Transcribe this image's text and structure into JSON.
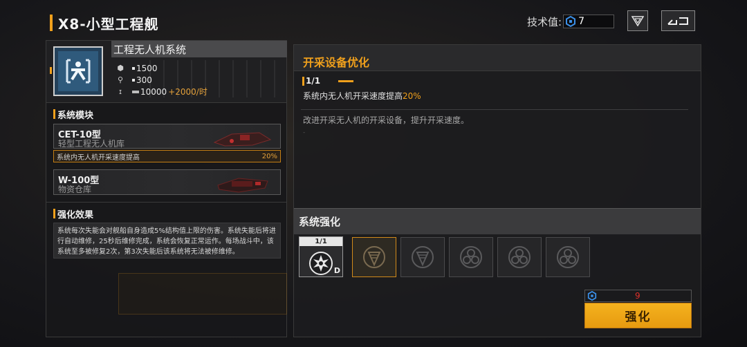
{
  "header": {
    "title": "X8-小型工程舰",
    "tech_label": "技术值:",
    "tech_value": "7",
    "filter_icon": "triangle-filter-icon",
    "back_icon": "back-arrow-icon"
  },
  "system": {
    "name": "工程无人机系统",
    "icon": "engineering-drone-icon",
    "stats": {
      "capacity": "1500",
      "drones": "300",
      "energy": "10000",
      "energy_rate": "+2000/时"
    }
  },
  "modules": {
    "section_title": "系统模块",
    "items": [
      {
        "code": "CET-10型",
        "type": "轻型工程无人机库"
      },
      {
        "code": "W-100型",
        "type": "物资仓库"
      }
    ],
    "effect_text": "系统内无人机开采速度提高",
    "effect_value": "20%"
  },
  "enhance_effect": {
    "section_title": "强化效果",
    "description": "系统每次失能会对舰船自身造成5%结构值上限的伤害。系统失能后将进行自动维修，25秒后维修完成，系统会恢复正常运作。每场战斗中，该系统至多被修复2次，第3次失能后该系统将无法被修维修。"
  },
  "upgrade": {
    "title": "开采设备优化",
    "level": "1/1",
    "effect_prefix": "系统内无人机开采速度提高",
    "effect_pct": "20%",
    "description": "改进开采无人机的开采设备，提升开采速度。"
  },
  "system_enhance": {
    "title": "系统强化",
    "current_level": "1/1",
    "current_grade": "D",
    "slots": [
      "drill-icon",
      "drill-icon",
      "hex-cluster-icon",
      "hex-cluster-icon",
      "hex-cluster-icon"
    ]
  },
  "cost": {
    "value": "9",
    "button_label": "强化"
  },
  "colors": {
    "accent": "#f0a01c",
    "cost_red": "#e0302a"
  }
}
